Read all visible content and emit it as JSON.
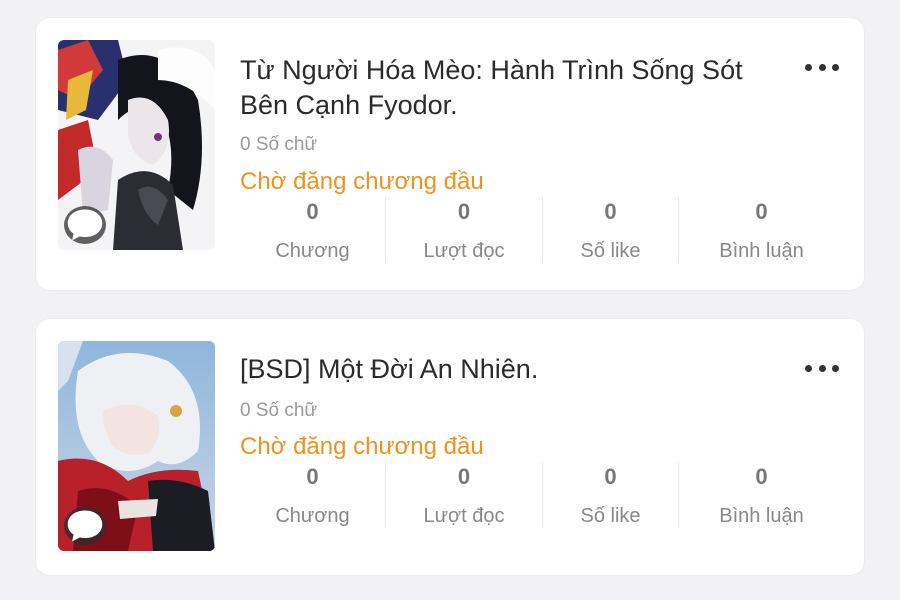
{
  "stories": [
    {
      "title": "Từ Người Hóa Mèo: Hành Trình Sống Sót Bên Cạnh Fyodor.",
      "word_count": "0 Số chữ",
      "status": "Chờ đăng chương đầu",
      "stats": [
        {
          "value": "0",
          "label": "Chương"
        },
        {
          "value": "0",
          "label": "Lượt đọc"
        },
        {
          "value": "0",
          "label": "Số like"
        },
        {
          "value": "0",
          "label": "Bình luận"
        }
      ]
    },
    {
      "title": "[BSD] Một Đời An Nhiên.",
      "word_count": "0 Số chữ",
      "status": "Chờ đăng chương đầu",
      "stats": [
        {
          "value": "0",
          "label": "Chương"
        },
        {
          "value": "0",
          "label": "Lượt đọc"
        },
        {
          "value": "0",
          "label": "Số like"
        },
        {
          "value": "0",
          "label": "Bình luận"
        }
      ]
    }
  ],
  "icons": {
    "more": "more-horizontal-icon",
    "chat": "chat-bubble-icon"
  },
  "colors": {
    "status": "#f0921c",
    "title": "#2b2b2b",
    "background": "#f2f2f4",
    "card": "#ffffff"
  }
}
